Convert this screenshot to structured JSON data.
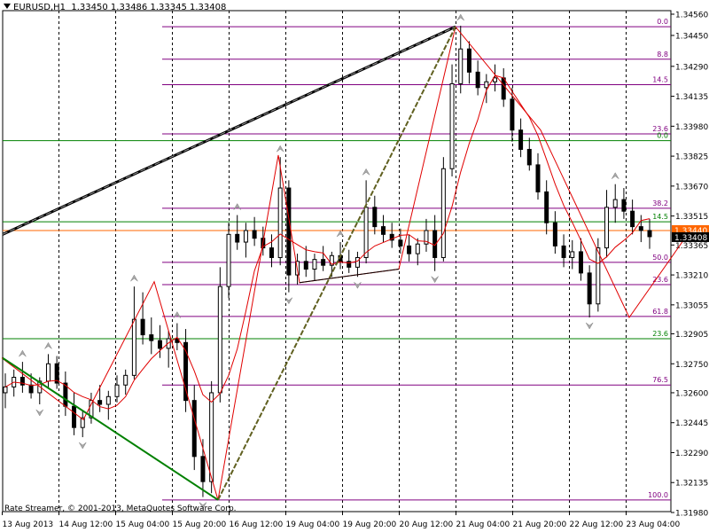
{
  "header": {
    "symbol": "EURUSD,H1",
    "open": "1.33450",
    "high": "1.33486",
    "low": "1.33345",
    "close": "1.33408"
  },
  "copyright": "Rate Streamer, © 2001-2013, MetaQuotes Software Corp.",
  "colors": {
    "background": "#ffffff",
    "grid": "#000000",
    "candle": "#000000",
    "ma_line": "#e00000",
    "zigzag": "#e00000",
    "fibo_purple": "#800080",
    "fibo_green": "#008000",
    "trend_dark": "#000000",
    "trend_green": "#008000",
    "current_price_line": "#ff6600",
    "price_tag_bg": "#000000",
    "price_tag_orange": "#ff6600",
    "fractal_arrow": "#a8a8a8"
  },
  "chart_data": {
    "type": "candlestick",
    "symbol": "EURUSD",
    "timeframe": "H1",
    "y_ticks": [
      "1.34560",
      "1.34450",
      "1.34290",
      "1.34135",
      "1.33980",
      "1.33825",
      "1.33670",
      "1.33515",
      "1.33365",
      "1.33210",
      "1.33055",
      "1.32905",
      "1.32750",
      "1.32600",
      "1.32445",
      "1.32290",
      "1.32135",
      "1.31980"
    ],
    "x_ticks": [
      "13 Aug 2013",
      "14 Aug 12:00",
      "15 Aug 04:00",
      "15 Aug 20:00",
      "16 Aug 12:00",
      "19 Aug 04:00",
      "19 Aug 20:00",
      "20 Aug 12:00",
      "21 Aug 04:00",
      "21 Aug 20:00",
      "22 Aug 12:00",
      "23 Aug 04:00"
    ],
    "ylim": [
      1.3198,
      1.3456
    ],
    "current_price": "1.33408",
    "current_price_secondary": "1.33440",
    "grid": true,
    "fibo_sets": [
      {
        "color": "purple",
        "levels": [
          {
            "label": "0.0",
            "price": 1.34495
          },
          {
            "label": "8.8",
            "price": 1.34327
          },
          {
            "label": "14.5",
            "price": 1.34195
          },
          {
            "label": "23.6",
            "price": 1.3394
          },
          {
            "label": "38.2",
            "price": 1.33555
          },
          {
            "label": "50.0",
            "price": 1.33275
          },
          {
            "label": "23.6",
            "price": 1.3316
          },
          {
            "label": "61.8",
            "price": 1.32995
          },
          {
            "label": "76.5",
            "price": 1.3264
          },
          {
            "label": "100.0",
            "price": 1.32045
          }
        ]
      },
      {
        "color": "green",
        "levels": [
          {
            "label": "0.0",
            "price": 1.33905
          },
          {
            "label": "14.5",
            "price": 1.33485
          },
          {
            "label": "23.6",
            "price": 1.3288
          }
        ]
      }
    ],
    "zigzag": [
      [
        "13 Aug 00:00",
        1.3278
      ],
      [
        "13 Aug 23:00",
        1.3246
      ],
      [
        "14 Aug 19:00",
        1.33175
      ],
      [
        "15 Aug 13:00",
        1.32045
      ],
      [
        "16 Aug 06:00",
        1.3383
      ],
      [
        "16 Aug 12:00",
        1.3317
      ],
      [
        "19 Aug 16:00",
        1.3324
      ],
      [
        "20 Aug 08:00",
        1.34495
      ],
      [
        "21 Aug 08:00",
        1.3396
      ],
      [
        "22 Aug 09:00",
        1.3299
      ],
      [
        "23 Aug 03:00",
        1.3346
      ]
    ],
    "candles": [
      [
        1.326,
        1.327,
        1.3252,
        1.3263
      ],
      [
        1.3263,
        1.3272,
        1.3258,
        1.3268
      ],
      [
        1.3268,
        1.3276,
        1.326,
        1.3264
      ],
      [
        1.3264,
        1.327,
        1.3257,
        1.326
      ],
      [
        1.326,
        1.3268,
        1.3254,
        1.3266
      ],
      [
        1.3266,
        1.328,
        1.3262,
        1.3275
      ],
      [
        1.3275,
        1.3279,
        1.3262,
        1.3265
      ],
      [
        1.3265,
        1.3271,
        1.3248,
        1.3253
      ],
      [
        1.3253,
        1.326,
        1.3238,
        1.3242
      ],
      [
        1.3242,
        1.3251,
        1.3237,
        1.3247
      ],
      [
        1.3247,
        1.326,
        1.3244,
        1.3256
      ],
      [
        1.3256,
        1.3264,
        1.325,
        1.3254
      ],
      [
        1.3254,
        1.3261,
        1.3246,
        1.3258
      ],
      [
        1.3258,
        1.3269,
        1.3255,
        1.3264
      ],
      [
        1.3264,
        1.3272,
        1.3259,
        1.3269
      ],
      [
        1.3269,
        1.3315,
        1.3267,
        1.3298
      ],
      [
        1.3298,
        1.3312,
        1.3285,
        1.329
      ],
      [
        1.329,
        1.3299,
        1.328,
        1.3287
      ],
      [
        1.3287,
        1.3295,
        1.3278,
        1.3283
      ],
      [
        1.3283,
        1.3292,
        1.3273,
        1.3288
      ],
      [
        1.3288,
        1.3296,
        1.3282,
        1.3286
      ],
      [
        1.3286,
        1.3293,
        1.325,
        1.3256
      ],
      [
        1.3256,
        1.3264,
        1.322,
        1.3227
      ],
      [
        1.3227,
        1.3236,
        1.3206,
        1.3214
      ],
      [
        1.3214,
        1.3266,
        1.3208,
        1.326
      ],
      [
        1.326,
        1.3325,
        1.3255,
        1.3315
      ],
      [
        1.3315,
        1.3348,
        1.3309,
        1.3342
      ],
      [
        1.3342,
        1.3352,
        1.3334,
        1.3338
      ],
      [
        1.3338,
        1.3348,
        1.333,
        1.3344
      ],
      [
        1.3344,
        1.3351,
        1.3336,
        1.334
      ],
      [
        1.334,
        1.3346,
        1.3331,
        1.3335
      ],
      [
        1.3335,
        1.3342,
        1.3325,
        1.333
      ],
      [
        1.333,
        1.3382,
        1.3326,
        1.3366
      ],
      [
        1.3366,
        1.337,
        1.3312,
        1.3321
      ],
      [
        1.3321,
        1.3332,
        1.3316,
        1.3328
      ],
      [
        1.3328,
        1.3336,
        1.332,
        1.3324
      ],
      [
        1.3324,
        1.3332,
        1.3318,
        1.3329
      ],
      [
        1.3329,
        1.3336,
        1.3323,
        1.3326
      ],
      [
        1.3326,
        1.3333,
        1.332,
        1.3331
      ],
      [
        1.3331,
        1.3338,
        1.3324,
        1.3328
      ],
      [
        1.3328,
        1.3334,
        1.3322,
        1.3325
      ],
      [
        1.3325,
        1.3333,
        1.332,
        1.333
      ],
      [
        1.333,
        1.337,
        1.3327,
        1.3356
      ],
      [
        1.3356,
        1.3362,
        1.3342,
        1.3346
      ],
      [
        1.3346,
        1.3352,
        1.3338,
        1.3342
      ],
      [
        1.3342,
        1.3348,
        1.3335,
        1.3339
      ],
      [
        1.3339,
        1.3345,
        1.3332,
        1.3336
      ],
      [
        1.3336,
        1.3342,
        1.3328,
        1.3332
      ],
      [
        1.3332,
        1.334,
        1.3326,
        1.3337
      ],
      [
        1.3337,
        1.335,
        1.3333,
        1.3344
      ],
      [
        1.3344,
        1.3352,
        1.3323,
        1.333
      ],
      [
        1.333,
        1.3382,
        1.3328,
        1.3376
      ],
      [
        1.3376,
        1.343,
        1.3372,
        1.342
      ],
      [
        1.342,
        1.345,
        1.3415,
        1.3438
      ],
      [
        1.3438,
        1.3442,
        1.342,
        1.3426
      ],
      [
        1.3426,
        1.3432,
        1.3414,
        1.3418
      ],
      [
        1.3418,
        1.3425,
        1.341,
        1.3421
      ],
      [
        1.3421,
        1.343,
        1.3416,
        1.3423
      ],
      [
        1.3423,
        1.3428,
        1.3408,
        1.3412
      ],
      [
        1.3412,
        1.3418,
        1.339,
        1.3396
      ],
      [
        1.3396,
        1.3402,
        1.3382,
        1.3386
      ],
      [
        1.3386,
        1.3392,
        1.3375,
        1.3378
      ],
      [
        1.3378,
        1.3384,
        1.336,
        1.3364
      ],
      [
        1.3364,
        1.337,
        1.3342,
        1.3348
      ],
      [
        1.3348,
        1.3354,
        1.3332,
        1.3336
      ],
      [
        1.3336,
        1.3342,
        1.3325,
        1.333
      ],
      [
        1.333,
        1.3339,
        1.3324,
        1.3333
      ],
      [
        1.3333,
        1.334,
        1.3318,
        1.3322
      ],
      [
        1.3322,
        1.3326,
        1.3299,
        1.3306
      ],
      [
        1.3306,
        1.334,
        1.3302,
        1.3335
      ],
      [
        1.3335,
        1.3365,
        1.333,
        1.3356
      ],
      [
        1.3356,
        1.3368,
        1.3348,
        1.336
      ],
      [
        1.336,
        1.3366,
        1.335,
        1.3354
      ],
      [
        1.3354,
        1.336,
        1.3342,
        1.3346
      ],
      [
        1.3346,
        1.3352,
        1.3338,
        1.3344
      ],
      [
        1.3344,
        1.335,
        1.33345,
        1.33408
      ]
    ]
  }
}
